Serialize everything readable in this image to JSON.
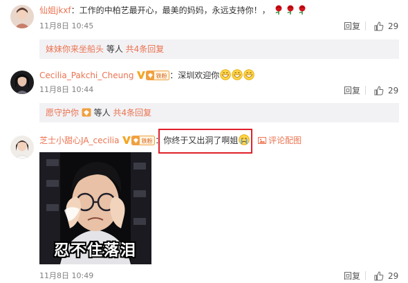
{
  "comments": [
    {
      "username": "仙姐jkxf",
      "separator": "：",
      "text": "工作的中柏艺最开心，最美的妈妈，永远支持你！，",
      "emoji_icons": [
        "rose-icon",
        "rose-icon",
        "rose-icon"
      ],
      "time": "11月8日 10:45",
      "reply_label": "回复",
      "likes": "29",
      "reply_summary": {
        "names": "妹妹你来坐船头",
        "middle": " 等人 ",
        "total": "共4条回复"
      }
    },
    {
      "username": "Cecilia_Pakchi_Cheung",
      "fan_badge": "铁粉",
      "separator": "：",
      "text": "深圳欢迎你",
      "emoji_icons": [
        "grin-icon",
        "grin-icon",
        "grin-icon"
      ],
      "time": "11月8日 10:44",
      "reply_label": "回复",
      "likes": "29",
      "reply_summary": {
        "names": "愿守护你",
        "middle": " 等人 ",
        "total": "共4条回复"
      }
    },
    {
      "username": "芝士小甜心JA_cecilia",
      "fan_badge": "铁粉",
      "separator": "：",
      "text": "你终于又出洞了啊姐",
      "emoji_icons": [
        "crying-icon"
      ],
      "image_comment_label": "评论配图",
      "gif_caption": "忍不住落泪",
      "time": "11月8日 10:49",
      "reply_label": "回复",
      "likes": "29"
    }
  ],
  "colors": {
    "username": "#eb7350",
    "highlight_box": "#e0202a",
    "reply_bar_bg": "#f2f2f5",
    "meta": "#808080"
  }
}
